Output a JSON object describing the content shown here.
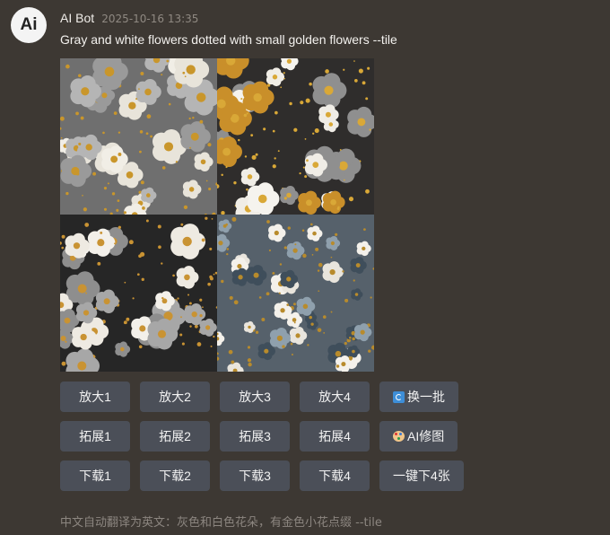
{
  "message": {
    "avatar_text": "Ai",
    "sender": "AI Bot",
    "timestamp": "2025-10-16 13:35",
    "prompt": "Gray and white flowers dotted with small golden flowers --tile",
    "translation_note": "中文自动翻译为英文：灰色和白色花朵，有金色小花点缀 --tile"
  },
  "images": [
    {
      "alt": "variant-1",
      "bg": "#6f6f6f"
    },
    {
      "alt": "variant-2",
      "bg": "#2f2d2c"
    },
    {
      "alt": "variant-3",
      "bg": "#262626"
    },
    {
      "alt": "variant-4",
      "bg": "#56616b"
    }
  ],
  "buttons": {
    "upscale": [
      "放大1",
      "放大2",
      "放大3",
      "放大4"
    ],
    "reroll": "换一批",
    "expand": [
      "拓展1",
      "拓展2",
      "拓展3",
      "拓展4"
    ],
    "ai_edit": "AI修图",
    "download": [
      "下载1",
      "下载2",
      "下载3",
      "下载4"
    ],
    "download_all": "一键下4张"
  },
  "colors": {
    "background": "#3d3833",
    "button": "#4b4f58",
    "gold": "#c9962b"
  },
  "icons": {
    "reroll": "refresh-icon",
    "ai_edit": "palette-icon"
  }
}
